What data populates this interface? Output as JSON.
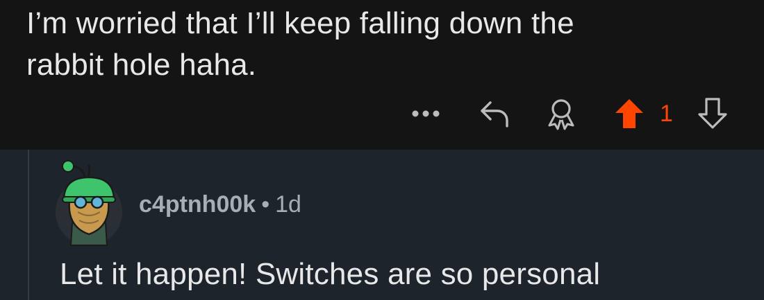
{
  "parent_comment": {
    "body_line1": "I’m worried that I’ll keep falling down the",
    "body_line2": "rabbit hole haha.",
    "vote_count": "1",
    "icons": [
      "more-icon",
      "reply-icon",
      "award-icon",
      "upvote-icon",
      "downvote-icon"
    ]
  },
  "reply": {
    "username": "c4ptnh00k",
    "separator": "•",
    "age": "1d",
    "body": "Let it happen! Switches are so personal",
    "avatar_icon": "snoo-avatar"
  },
  "colors": {
    "background_top": "#141414",
    "background_reply": "#1e242c",
    "upvote_accent": "#ff4500",
    "text": "#e8e8e8",
    "meta_text": "#a8aeb6"
  }
}
